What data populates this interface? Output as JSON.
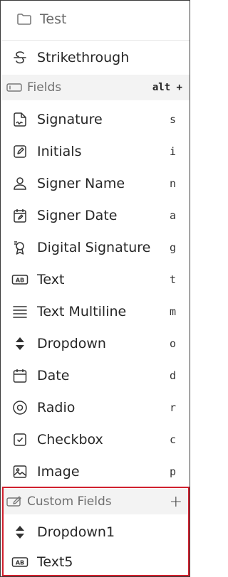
{
  "folder": {
    "label": "Test",
    "icon": "folder-icon"
  },
  "strikethrough": {
    "label": "Strikethrough",
    "icon": "strikethrough-icon"
  },
  "fields_section": {
    "label": "Fields",
    "shortcut": "alt +",
    "icon": "input-field-icon"
  },
  "fields": [
    {
      "label": "Signature",
      "key": "s",
      "icon": "signature-icon"
    },
    {
      "label": "Initials",
      "key": "i",
      "icon": "initials-icon"
    },
    {
      "label": "Signer Name",
      "key": "n",
      "icon": "user-icon"
    },
    {
      "label": "Signer Date",
      "key": "a",
      "icon": "calendar-pen-icon"
    },
    {
      "label": "Digital Signature",
      "key": "g",
      "icon": "certificate-icon"
    },
    {
      "label": "Text",
      "key": "t",
      "icon": "text-ab-icon"
    },
    {
      "label": "Text Multiline",
      "key": "m",
      "icon": "multiline-icon"
    },
    {
      "label": "Dropdown",
      "key": "o",
      "icon": "dropdown-icon"
    },
    {
      "label": "Date",
      "key": "d",
      "icon": "calendar-icon"
    },
    {
      "label": "Radio",
      "key": "r",
      "icon": "radio-icon"
    },
    {
      "label": "Checkbox",
      "key": "c",
      "icon": "checkbox-icon"
    },
    {
      "label": "Image",
      "key": "p",
      "icon": "image-icon"
    }
  ],
  "custom_section": {
    "label": "Custom Fields",
    "add": "+",
    "icon": "edit-field-icon"
  },
  "custom_fields": [
    {
      "label": "Dropdown1",
      "icon": "dropdown-icon"
    },
    {
      "label": "Text5",
      "icon": "text-ab-icon"
    }
  ],
  "colors": {
    "highlight_border": "#d0202e",
    "section_bg": "#f3f3f3"
  }
}
